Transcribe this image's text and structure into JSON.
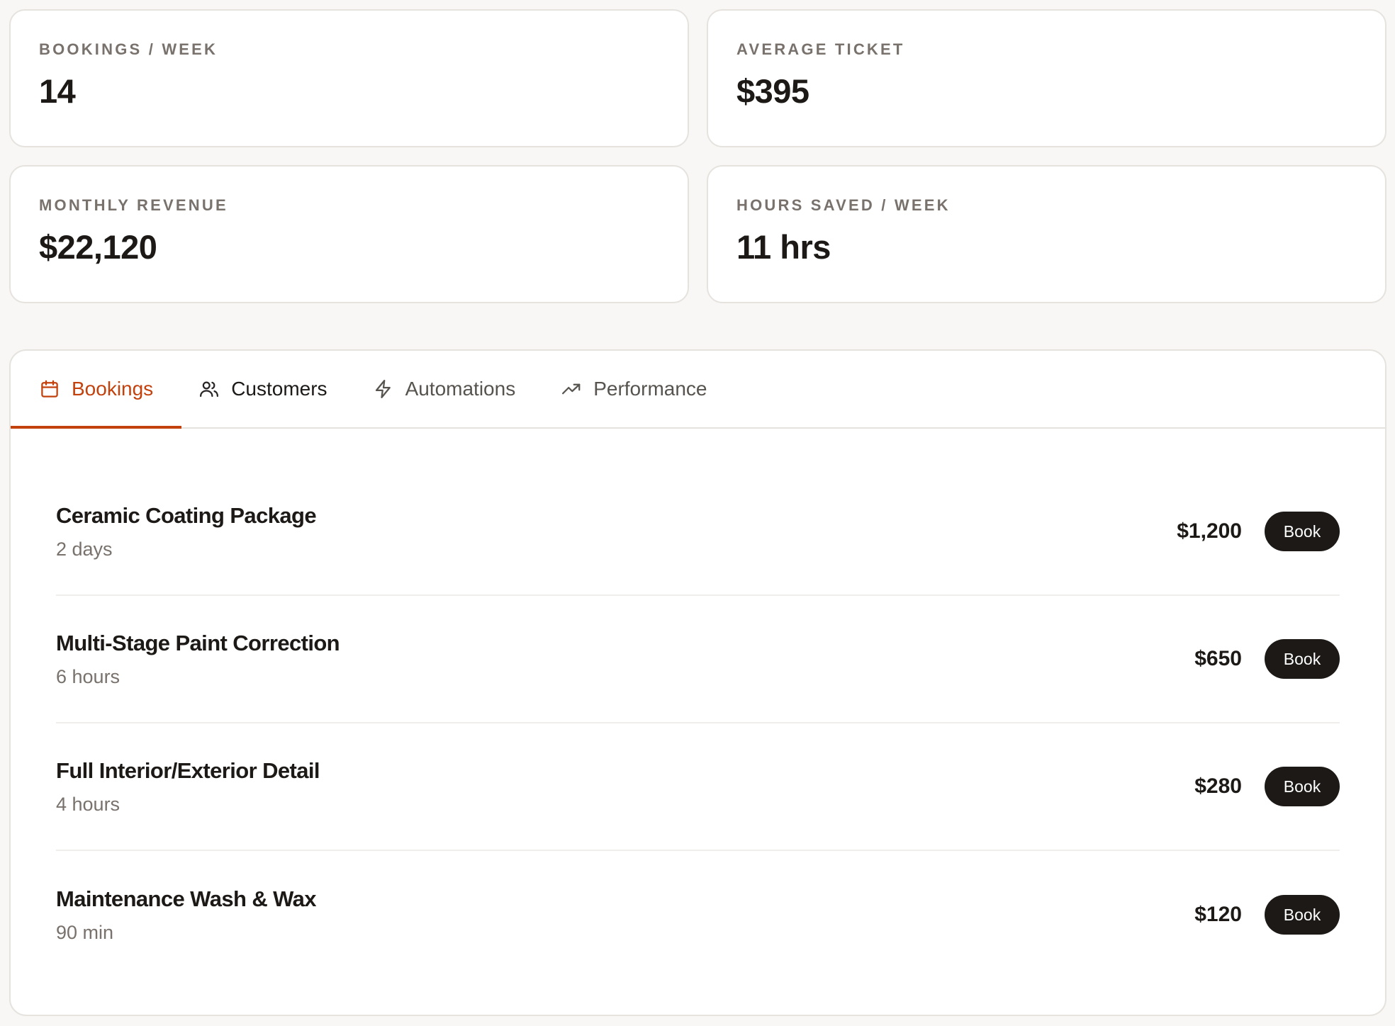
{
  "stats": [
    {
      "label": "BOOKINGS / WEEK",
      "value": "14"
    },
    {
      "label": "AVERAGE TICKET",
      "value": "$395"
    },
    {
      "label": "MONTHLY REVENUE",
      "value": "$22,120"
    },
    {
      "label": "HOURS SAVED / WEEK",
      "value": "11 hrs"
    }
  ],
  "tabs": [
    {
      "label": "Bookings",
      "icon": "calendar-icon",
      "active": true
    },
    {
      "label": "Customers",
      "icon": "users-icon",
      "active": false
    },
    {
      "label": "Automations",
      "icon": "lightning-icon",
      "active": false
    },
    {
      "label": "Performance",
      "icon": "trending-up-icon",
      "active": false
    }
  ],
  "services": [
    {
      "name": "Ceramic Coating Package",
      "duration": "2 days",
      "price": "$1,200",
      "action": "Book"
    },
    {
      "name": "Multi-Stage Paint Correction",
      "duration": "6 hours",
      "price": "$650",
      "action": "Book"
    },
    {
      "name": "Full Interior/Exterior Detail",
      "duration": "4 hours",
      "price": "$280",
      "action": "Book"
    },
    {
      "name": "Maintenance Wash & Wax",
      "duration": "90 min",
      "price": "$120",
      "action": "Book"
    }
  ],
  "colors": {
    "accent": "#c2410c",
    "button_bg": "#1c1917",
    "page_bg": "#f8f7f5"
  }
}
